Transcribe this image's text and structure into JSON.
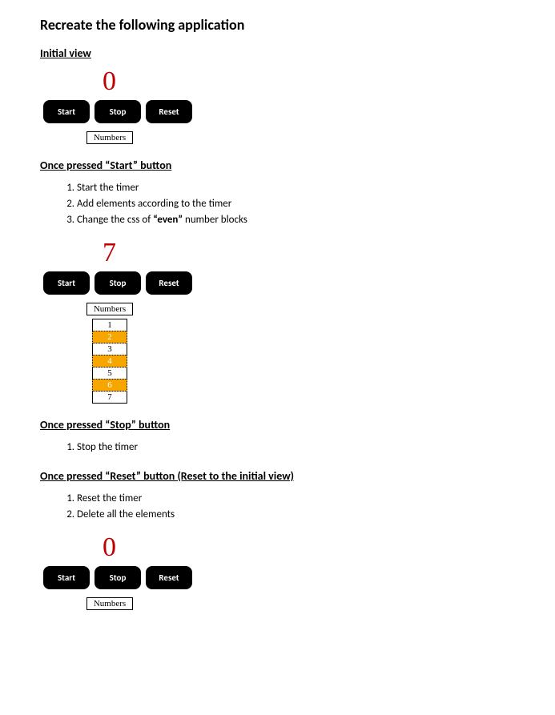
{
  "title": "Recreate the following application",
  "sections": {
    "initial": {
      "heading": "Initial view",
      "counter": "0",
      "buttons": {
        "start": "Start",
        "stop": "Stop",
        "reset": "Reset"
      },
      "numbers_header": "Numbers"
    },
    "start": {
      "heading": "Once pressed “Start” button",
      "steps": [
        "Start the timer",
        "Add elements according to the timer",
        [
          "Change the css of ",
          "“even”",
          " number blocks"
        ]
      ],
      "counter": "7",
      "buttons": {
        "start": "Start",
        "stop": "Stop",
        "reset": "Reset"
      },
      "numbers_header": "Numbers",
      "numbers": [
        "1",
        "2",
        "3",
        "4",
        "5",
        "6",
        "7"
      ]
    },
    "stop": {
      "heading": "Once pressed “Stop” button",
      "steps": [
        "Stop the timer"
      ]
    },
    "reset": {
      "heading": "Once pressed “Reset” button (Reset to the initial view)",
      "steps": [
        "Reset the timer",
        "Delete all the elements"
      ],
      "counter": "0",
      "buttons": {
        "start": "Start",
        "stop": "Stop",
        "reset": "Reset"
      },
      "numbers_header": "Numbers"
    }
  }
}
